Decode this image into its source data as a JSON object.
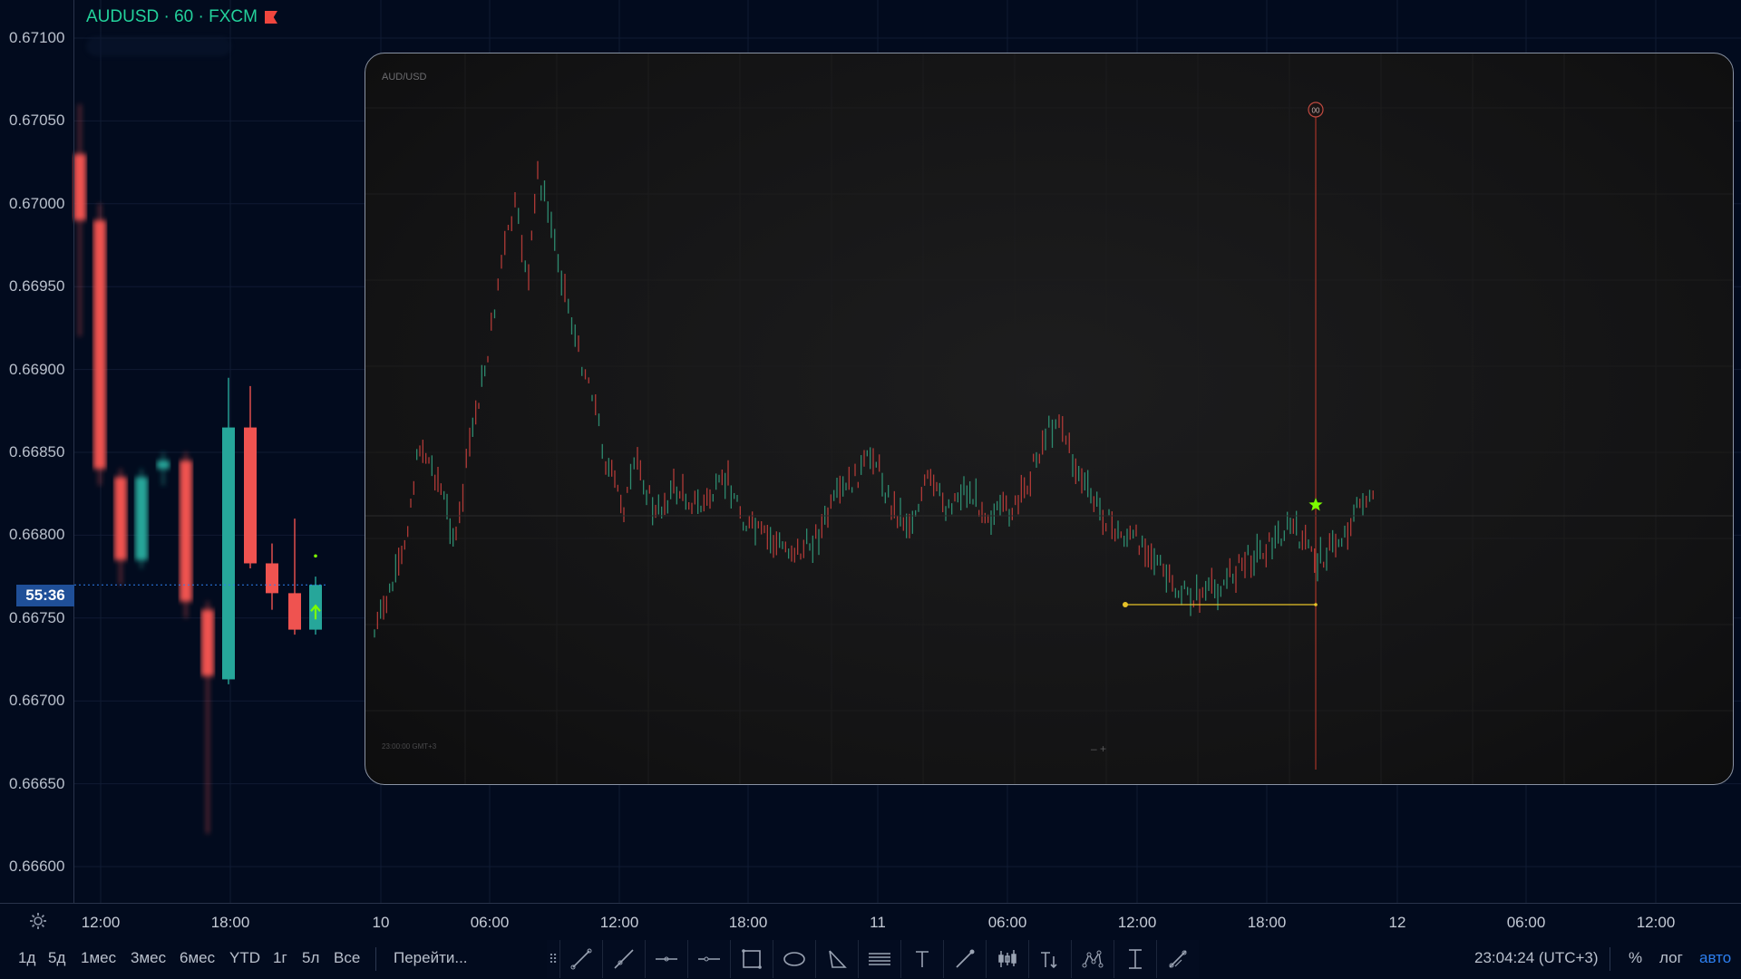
{
  "header": {
    "symbol": "AUDUSD · 60 · FXCM"
  },
  "price_axis": {
    "labels": [
      "0.67100",
      "0.67050",
      "0.67000",
      "0.66950",
      "0.66900",
      "0.66850",
      "0.66800",
      "0.66750",
      "0.66700",
      "0.66650",
      "0.66600"
    ],
    "countdown": "55:36"
  },
  "time_axis": {
    "labels": [
      "12:00",
      "18:00",
      "10",
      "06:00",
      "12:00",
      "18:00",
      "11",
      "06:00",
      "12:00",
      "18:00",
      "12",
      "06:00",
      "12:00"
    ]
  },
  "bottom_toolbar": {
    "ranges": [
      "1д",
      "5д",
      "1мес",
      "3мес",
      "6мес",
      "YTD",
      "1г",
      "5л",
      "Все"
    ],
    "goto": "Перейти...",
    "clock": "23:04:24 (UTC+3)",
    "percent": "%",
    "log": "лог",
    "auto": "авто"
  },
  "drawing_tools": [
    "trend-line",
    "ray",
    "horizontal-line",
    "horizontal-ray",
    "rectangle",
    "ellipse",
    "triangle",
    "parallel-channel",
    "text",
    "brush",
    "candles-pattern",
    "text-annotation",
    "pattern",
    "price-range",
    "date-range"
  ],
  "inset": {
    "symbol": "AUD/USD",
    "timezone_note": "23:00:00 GMT+3",
    "zoom": "–  +",
    "marker_label": "00"
  },
  "colors": {
    "background": "#020b1e",
    "up": "#26a69a",
    "down": "#ef5350",
    "accent": "#2d7ff0",
    "title": "#23d19b",
    "inset_line": "#c0392b",
    "inset_star": "#7cfc00",
    "inset_level": "#e6c229"
  },
  "chart_data": {
    "type": "candlestick",
    "symbol": "AUDUSD",
    "interval": "60",
    "visible_candles": [
      {
        "open": 0.6703,
        "high": 0.6706,
        "low": 0.6692,
        "close": 0.6699
      },
      {
        "open": 0.6699,
        "high": 0.67,
        "low": 0.6683,
        "close": 0.6684
      },
      {
        "open": 0.66835,
        "high": 0.6684,
        "low": 0.6677,
        "close": 0.66785
      },
      {
        "open": 0.66785,
        "high": 0.6684,
        "low": 0.6678,
        "close": 0.66835
      },
      {
        "open": 0.6684,
        "high": 0.6685,
        "low": 0.6683,
        "close": 0.66845
      },
      {
        "open": 0.66845,
        "high": 0.6685,
        "low": 0.6675,
        "close": 0.6676
      },
      {
        "open": 0.66755,
        "high": 0.6676,
        "low": 0.6662,
        "close": 0.66715
      },
      {
        "open": 0.66713,
        "high": 0.66895,
        "low": 0.6671,
        "close": 0.66865
      },
      {
        "open": 0.66865,
        "high": 0.6689,
        "low": 0.6678,
        "close": 0.66783
      },
      {
        "open": 0.66783,
        "high": 0.66795,
        "low": 0.66755,
        "close": 0.66765
      },
      {
        "open": 0.66765,
        "high": 0.6681,
        "low": 0.6674,
        "close": 0.66743
      },
      {
        "open": 0.66743,
        "high": 0.66775,
        "low": 0.6674,
        "close": 0.6677
      }
    ],
    "last_price": 0.6677
  }
}
